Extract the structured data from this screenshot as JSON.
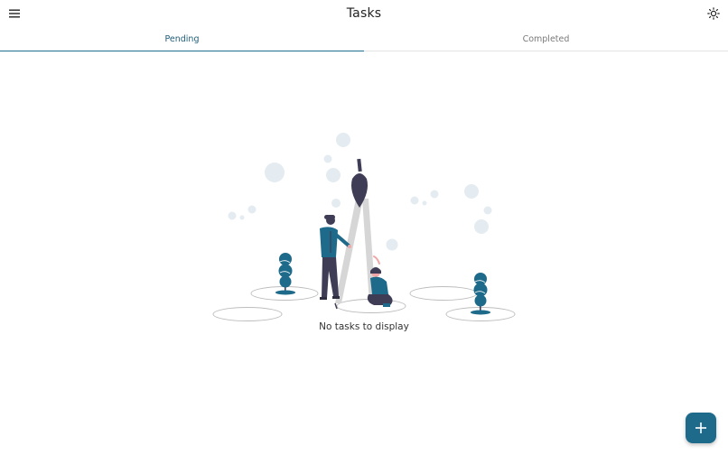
{
  "app": {
    "title": "Tasks"
  },
  "header": {
    "menu_icon": "hamburger-menu-icon",
    "theme_icon": "sun-icon"
  },
  "tabs": [
    {
      "label": "Pending",
      "active": true
    },
    {
      "label": "Completed",
      "active": false
    }
  ],
  "main": {
    "empty_message": "No tasks to display",
    "illustration": "empty-state-compass-illustration"
  },
  "fab": {
    "icon": "plus-icon"
  },
  "colors": {
    "accent": "#1d6a8a",
    "tab_active_text": "#1f5d78",
    "tab_inactive_text": "#7a7a7a",
    "bubble": "#e4ecf1",
    "compass_head": "#3f3d56",
    "compass_leg": "#d6d6d6"
  }
}
